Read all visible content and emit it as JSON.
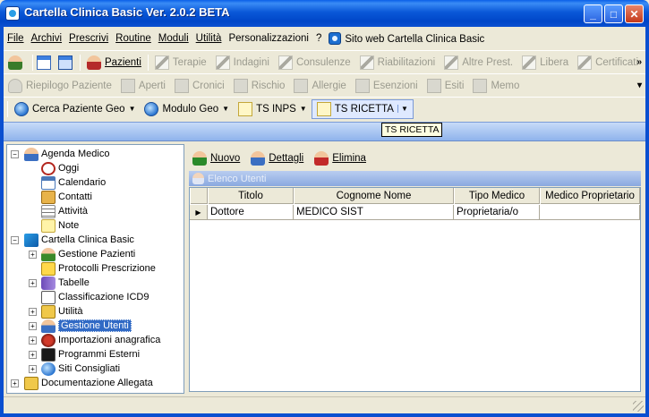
{
  "window": {
    "title": "Cartella Clinica Basic Ver. 2.0.2  BETA",
    "minimize": "_",
    "maximize": "□",
    "close": "✕"
  },
  "menu": {
    "file": "File",
    "archivi": "Archivi",
    "prescrivi": "Prescrivi",
    "routine": "Routine",
    "moduli": "Moduli",
    "utilita": "Utilità",
    "personalizzazioni": "Personalizzazioni",
    "help": "?",
    "sito_web": "Sito web Cartella Clinica Basic"
  },
  "toolbar1": {
    "pazienti": "Pazienti",
    "terapie": "Terapie",
    "indagini": "Indagini",
    "consulenze": "Consulenze",
    "riabilitazioni": "Riabilitazioni",
    "altre_prest": "Altre Prest.",
    "libera": "Libera",
    "certificati": "Certificati",
    "overflow": "»"
  },
  "toolbar2": {
    "riepilogo": "Riepilogo Paziente",
    "aperti": "Aperti",
    "cronici": "Cronici",
    "rischio": "Rischio",
    "allergie": "Allergie",
    "esenzioni": "Esenzioni",
    "esiti": "Esiti",
    "memo": "Memo",
    "overflow": "▾"
  },
  "toolbar3": {
    "cerca_paziente_geo": "Cerca Paziente Geo",
    "modulo_geo": "Modulo Geo",
    "ts_inps": "TS INPS",
    "ts_ricetta": "TS RICETTA"
  },
  "tooltip": "TS RICETTA",
  "tree": {
    "agenda_medico": "Agenda Medico",
    "oggi": "Oggi",
    "calendario": "Calendario",
    "contatti": "Contatti",
    "attivita": "Attività",
    "note": "Note",
    "cartella_clinica_basic": "Cartella Clinica Basic",
    "gestione_pazienti": "Gestione Pazienti",
    "protocolli_prescrizione": "Protocolli Prescrizione",
    "tabelle": "Tabelle",
    "classificazione_icd9": "Classificazione ICD9",
    "utilita": "Utilità",
    "gestione_utenti": "Gestione Utenti",
    "importazioni_anagrafica": "Importazioni anagrafica",
    "programmi_esterni": "Programmi Esterni",
    "siti_consigliati": "Siti Consigliati",
    "documentazione_allegata": "Documentazione Allegata"
  },
  "panel": {
    "nuovo": "Nuovo",
    "dettagli": "Dettagli",
    "elimina": "Elimina",
    "header": "Elenco Utenti"
  },
  "grid": {
    "columns": [
      "Titolo",
      "Cognome Nome",
      "Tipo Medico",
      "Medico Proprietario"
    ],
    "rows": [
      [
        "Dottore",
        "MEDICO SIST",
        "Proprietaria/o",
        ""
      ]
    ]
  }
}
